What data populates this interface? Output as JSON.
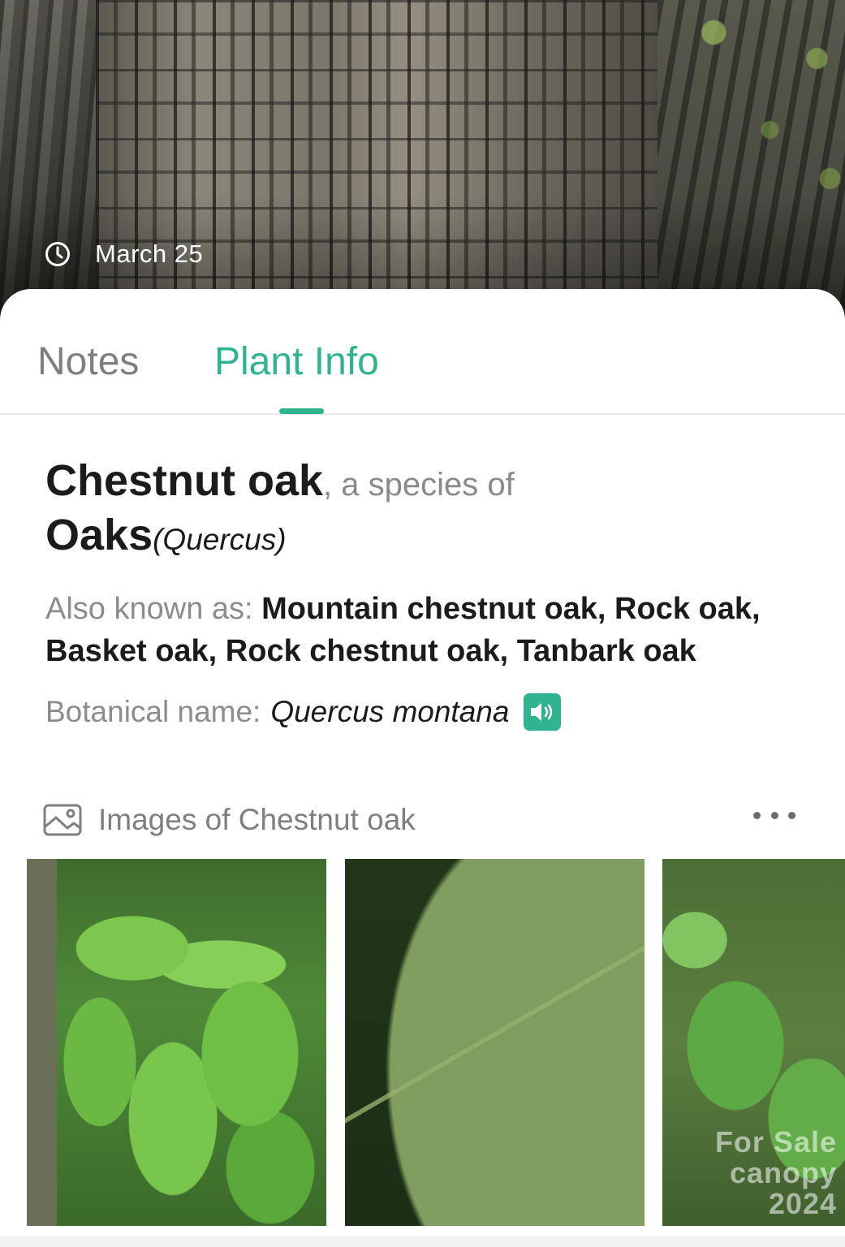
{
  "header": {
    "date": "March 25",
    "date_icon": "clock-icon"
  },
  "tabs": [
    {
      "label": "Notes",
      "active": false
    },
    {
      "label": "Plant Info",
      "active": true
    }
  ],
  "plant": {
    "common_name": "Chestnut oak",
    "species_of_text": ", a species of",
    "genus": "Oaks",
    "genus_latin": "(Quercus)",
    "also_known_as_label": "Also known as:",
    "also_known_as": "Mountain chestnut oak, Rock oak, Basket oak, Rock chestnut oak, Tanbark oak",
    "botanical_label": "Botanical name:",
    "botanical_name": "Quercus montana",
    "pronounce_icon": "speaker-icon"
  },
  "images": {
    "title": "Images of Chestnut oak",
    "icon": "gallery-icon",
    "more_icon": "more-horizontal-icon",
    "watermark": [
      "For Sale",
      "canopy 2024"
    ]
  },
  "colors": {
    "accent": "#2fb48f",
    "inactive_tab": "#7f7f7f",
    "text_primary": "#1b1b1b",
    "text_secondary": "#8c8c8c"
  }
}
